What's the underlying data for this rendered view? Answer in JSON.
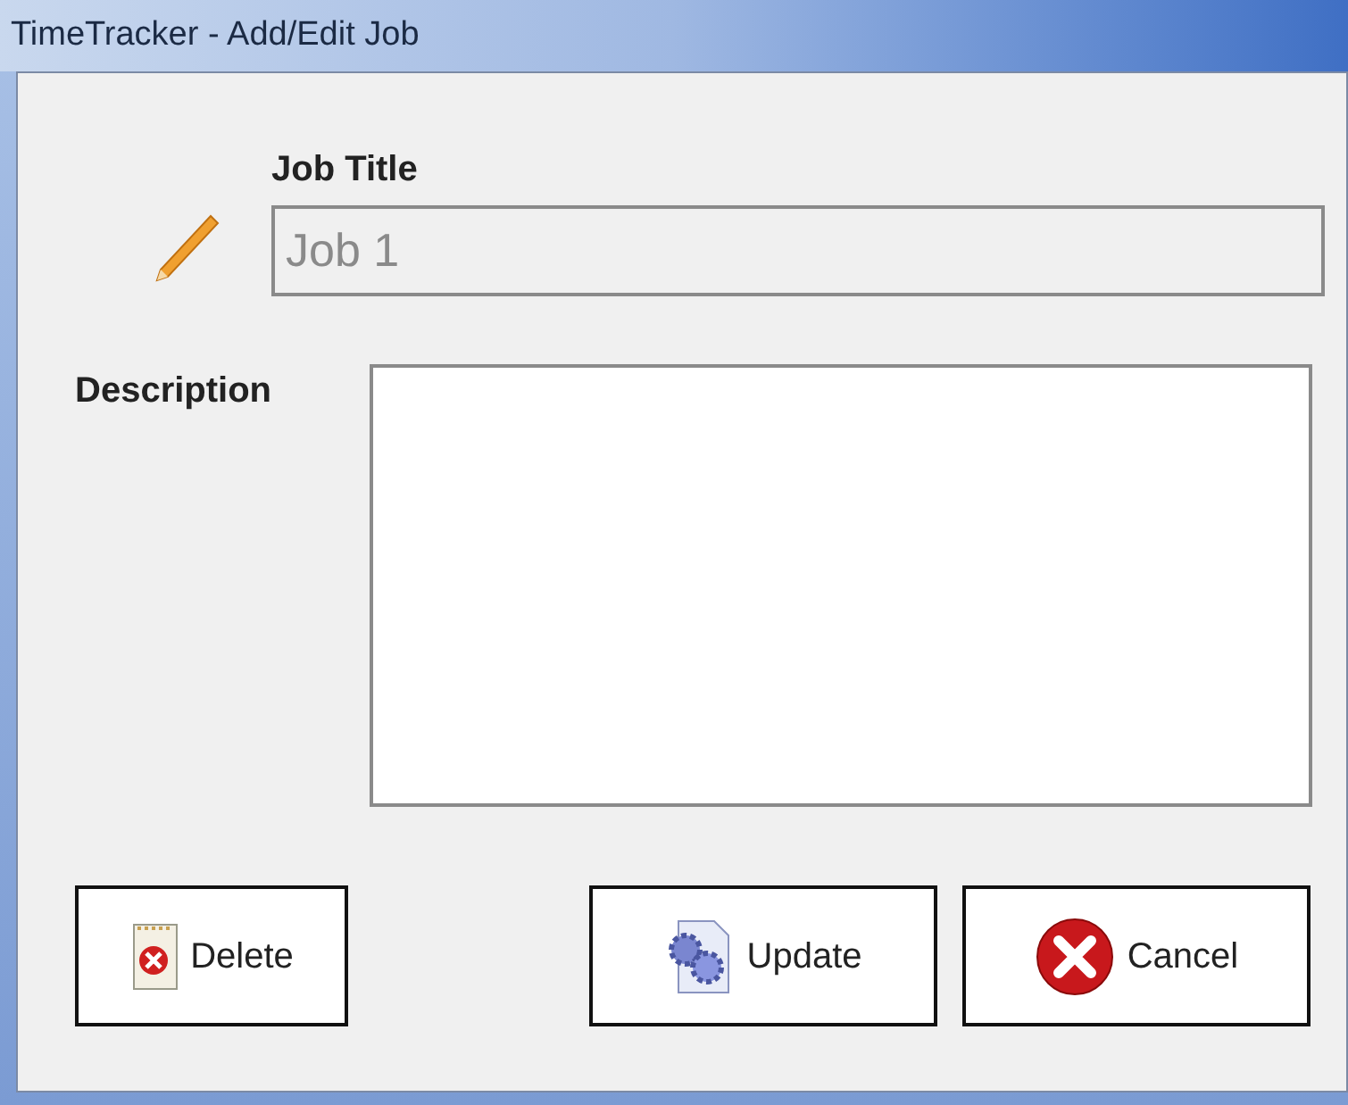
{
  "window": {
    "title": "TimeTracker - Add/Edit Job"
  },
  "job_title": {
    "label": "Job Title",
    "value": "Job 1",
    "disabled": true
  },
  "description": {
    "label": "Description"
  },
  "buttons": [
    {
      "label": "Delete",
      "kind": "delete"
    },
    {
      "label": "Update",
      "kind": "update"
    },
    {
      "label": "Cancel",
      "kind": "cancel"
    }
  ]
}
